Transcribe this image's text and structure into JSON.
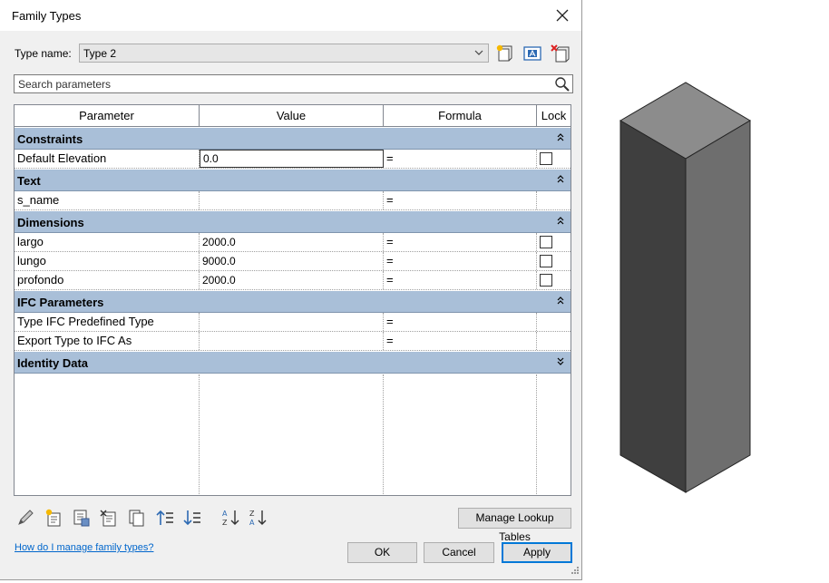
{
  "window": {
    "title": "Family Types"
  },
  "type_name": {
    "label": "Type name:",
    "value": "Type 2"
  },
  "search": {
    "placeholder": "Search parameters"
  },
  "grid": {
    "headers": {
      "parameter": "Parameter",
      "value": "Value",
      "formula": "Formula",
      "lock": "Lock"
    },
    "groups": [
      {
        "label": "Constraints",
        "rows": [
          {
            "parameter": "Default Elevation",
            "value": "0.0",
            "formula": "="
          }
        ]
      },
      {
        "label": "Text",
        "rows": [
          {
            "parameter": "s_name",
            "value": "",
            "formula": "="
          }
        ]
      },
      {
        "label": "Dimensions",
        "rows": [
          {
            "parameter": "largo",
            "value": "2000.0",
            "formula": "="
          },
          {
            "parameter": "lungo",
            "value": "9000.0",
            "formula": "="
          },
          {
            "parameter": "profondo",
            "value": "2000.0",
            "formula": "="
          }
        ]
      },
      {
        "label": "IFC Parameters",
        "rows": [
          {
            "parameter": "Type IFC Predefined Type",
            "value": "",
            "formula": "="
          },
          {
            "parameter": "Export Type to IFC As",
            "value": "",
            "formula": "="
          }
        ]
      },
      {
        "label": "Identity Data",
        "rows": []
      }
    ]
  },
  "buttons": {
    "manage_lookup": "Manage Lookup Tables",
    "ok": "OK",
    "cancel": "Cancel",
    "apply": "Apply"
  },
  "help_link": "How do I manage family types?",
  "colors": {
    "group_header": "#a9bfd8",
    "link": "#0066cc",
    "primary_border": "#0078d7"
  },
  "icons": {
    "type_toolbar": [
      "new-type-icon",
      "rename-type-icon",
      "delete-type-icon"
    ],
    "bottom_toolbar": [
      "edit-parameter-icon",
      "new-parameter-icon",
      "delete-parameter-icon",
      "manage-parameter-icon",
      "copy-parameter-icon",
      "move-up-icon",
      "move-down-icon",
      "sort-ascending-icon",
      "sort-descending-icon"
    ]
  }
}
